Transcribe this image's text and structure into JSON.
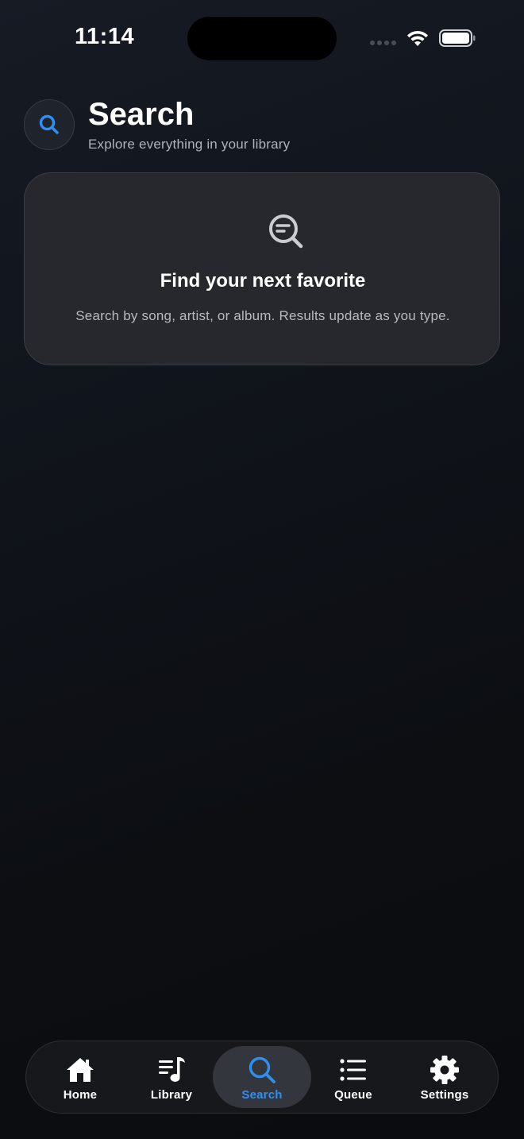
{
  "status_bar": {
    "time": "11:14"
  },
  "header": {
    "title": "Search",
    "subtitle": "Explore everything in your library",
    "icon": "search-icon"
  },
  "empty_state": {
    "icon": "search-list-icon",
    "title": "Find your next favorite",
    "description": "Search by song, artist, or album. Results update as you type."
  },
  "tab_bar": {
    "active": "Search",
    "tabs": [
      {
        "label": "Home",
        "icon": "home-icon"
      },
      {
        "label": "Library",
        "icon": "library-music-icon"
      },
      {
        "label": "Search",
        "icon": "search-icon"
      },
      {
        "label": "Queue",
        "icon": "queue-list-icon"
      },
      {
        "label": "Settings",
        "icon": "gear-icon"
      }
    ]
  },
  "colors": {
    "accent": "#2f8ff0",
    "background": "#0d0f13",
    "card": "#28292f"
  }
}
